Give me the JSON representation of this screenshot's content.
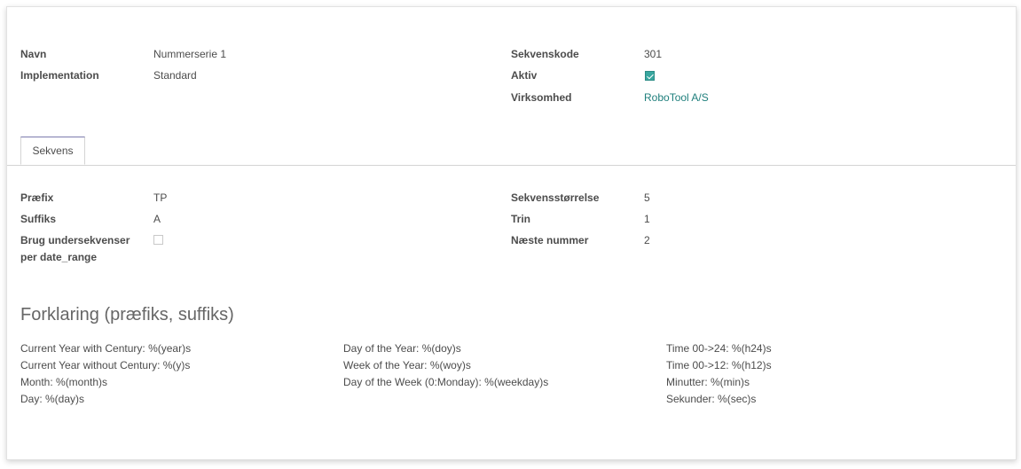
{
  "header_fields": {
    "name_label": "Navn",
    "name_value": "Nummerserie 1",
    "implementation_label": "Implementation",
    "implementation_value": "Standard",
    "code_label": "Sekvenskode",
    "code_value": "301",
    "active_label": "Aktiv",
    "active_checked": true,
    "company_label": "Virksomhed",
    "company_value": "RoboTool A/S"
  },
  "tabs": [
    {
      "label": "Sekvens",
      "active": true
    }
  ],
  "sequence": {
    "prefix_label": "Præfix",
    "prefix_value": "TP",
    "suffix_label": "Suffiks",
    "suffix_value": "A",
    "use_subsequences_label_1": "Brug undersekvenser",
    "use_subsequences_label_2": "per date_range",
    "use_subsequences_checked": false,
    "size_label": "Sekvensstørrelse",
    "size_value": "5",
    "step_label": "Trin",
    "step_value": "1",
    "next_label": "Næste nummer",
    "next_value": "2"
  },
  "legend": {
    "title": "Forklaring (præfiks, suffiks)",
    "col1": [
      "Current Year with Century: %(year)s",
      "Current Year without Century: %(y)s",
      "Month: %(month)s",
      "Day: %(day)s"
    ],
    "col2": [
      "Day of the Year: %(doy)s",
      "Week of the Year: %(woy)s",
      "Day of the Week (0:Monday): %(weekday)s"
    ],
    "col3": [
      "Time 00->24: %(h24)s",
      "Time 00->12: %(h12)s",
      "Minutter: %(min)s",
      "Sekunder: %(sec)s"
    ]
  },
  "colors": {
    "link": "#1f7f7c",
    "checkbox_on": "#38a69f",
    "tab_accent": "#7c7bad"
  }
}
